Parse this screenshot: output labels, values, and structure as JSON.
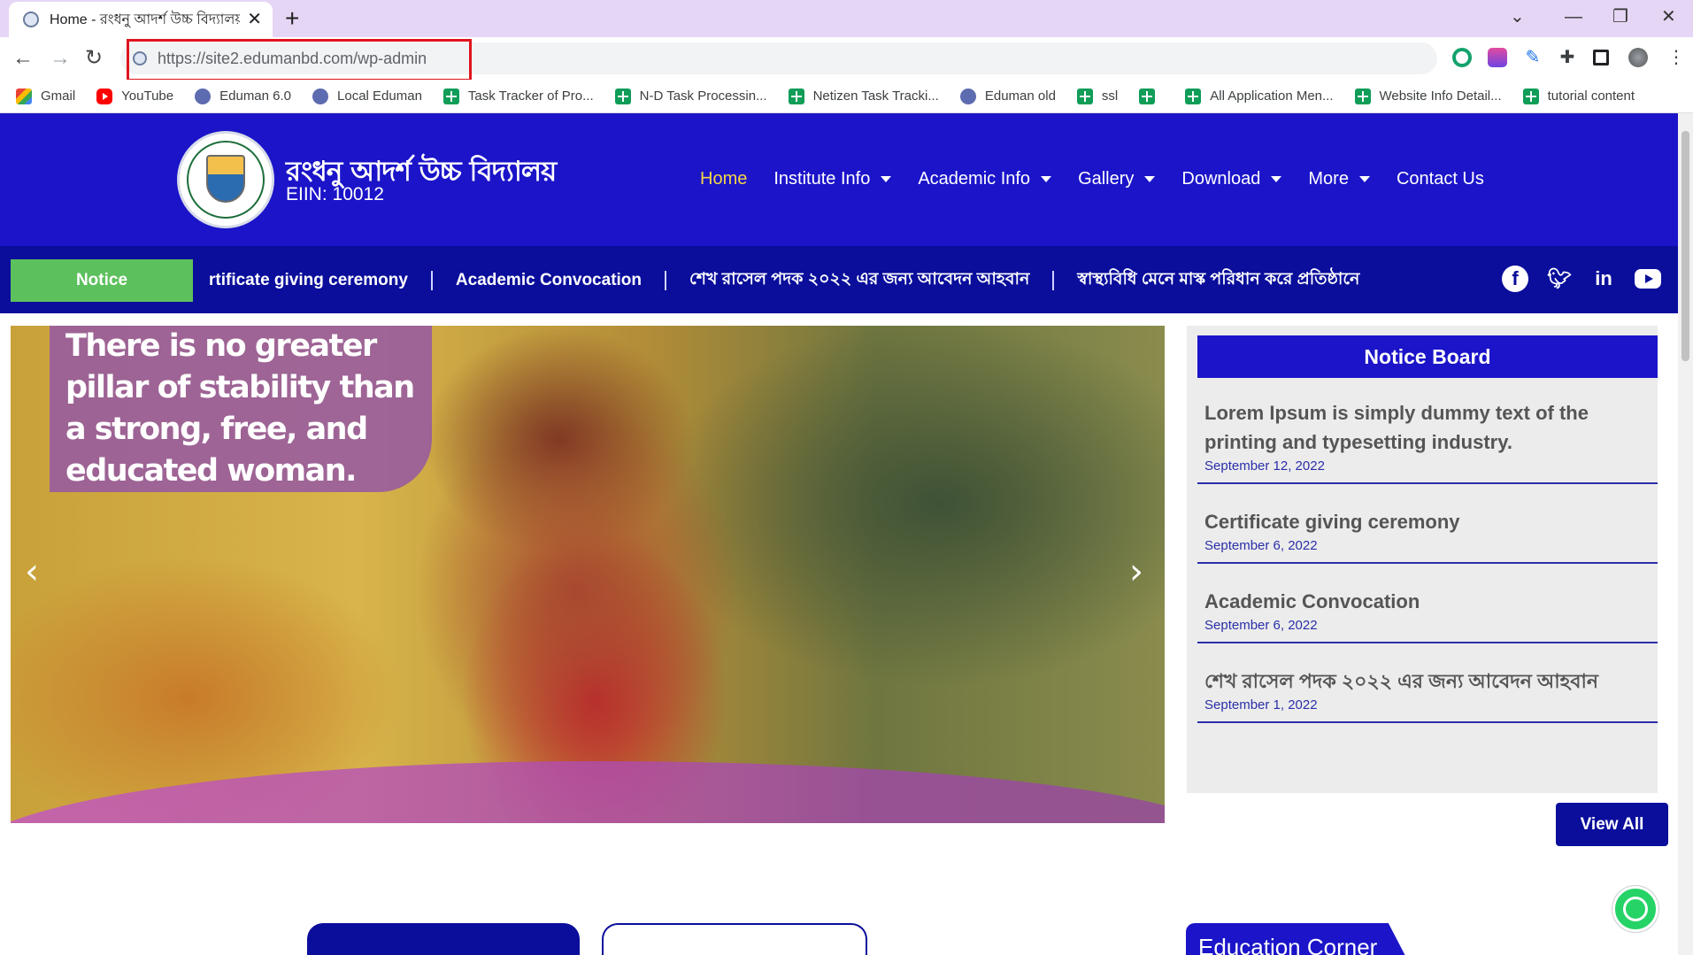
{
  "browser": {
    "tab_title": "Home - রংধনু আদর্শ উচ্চ বিদ্যালয়",
    "url": "https://site2.edumanbd.com/wp-admin",
    "bookmarks": [
      {
        "label": "Gmail",
        "icon": "gmail-icon"
      },
      {
        "label": "YouTube",
        "icon": "youtube-icon"
      },
      {
        "label": "Eduman 6.0",
        "icon": "eduman-icon"
      },
      {
        "label": "Local Eduman",
        "icon": "eduman-icon"
      },
      {
        "label": "Task Tracker of Pro...",
        "icon": "sheets-icon"
      },
      {
        "label": "N-D Task Processin...",
        "icon": "sheets-icon"
      },
      {
        "label": "Netizen Task Tracki...",
        "icon": "sheets-icon"
      },
      {
        "label": "Eduman old",
        "icon": "eduman-icon"
      },
      {
        "label": "ssl",
        "icon": "sheets-icon"
      },
      {
        "label": "",
        "icon": "sheets-icon"
      },
      {
        "label": "All Application Men...",
        "icon": "sheets-icon"
      },
      {
        "label": "Website Info Detail...",
        "icon": "sheets-icon"
      },
      {
        "label": "tutorial content",
        "icon": "sheets-icon"
      }
    ]
  },
  "site": {
    "school_name": "রংধনু আদর্শ উচ্চ বিদ্যালয়",
    "eiin": "EIIN: 10012",
    "nav": [
      {
        "label": "Home",
        "dropdown": false,
        "active": true
      },
      {
        "label": "Institute Info",
        "dropdown": true
      },
      {
        "label": "Academic Info",
        "dropdown": true
      },
      {
        "label": "Gallery",
        "dropdown": true
      },
      {
        "label": "Download",
        "dropdown": true
      },
      {
        "label": "More",
        "dropdown": true
      },
      {
        "label": "Contact Us",
        "dropdown": false
      }
    ]
  },
  "notice_bar": {
    "button_label": "Notice",
    "ticker": [
      "rtificate giving ceremony",
      "Academic Convocation",
      "শেখ রাসেল পদক ২০২২ এর জন্য আবেদন আহবান",
      "স্বাস্থ্যবিধি মেনে মাস্ক পরিধান করে প্রতিষ্ঠানে"
    ],
    "socials": [
      "facebook-icon",
      "twitter-icon",
      "linkedin-icon",
      "youtube-icon"
    ]
  },
  "hero": {
    "quote": "There is no greater pillar of stability than a strong, free, and educated woman."
  },
  "notice_board": {
    "title": "Notice Board",
    "items": [
      {
        "title": "Lorem Ipsum is simply dummy text of the printing and typesetting industry.",
        "date": "September 12, 2022"
      },
      {
        "title": "Certificate giving ceremony",
        "date": "September 6, 2022"
      },
      {
        "title": "Academic Convocation",
        "date": "September 6, 2022"
      },
      {
        "title": "শেখ রাসেল পদক ২০২২ এর জন্য আবেদন আহবান",
        "date": "September 1, 2022"
      }
    ],
    "view_all": "View All"
  },
  "sections": {
    "education_corner": "Education Corner"
  },
  "colors": {
    "header_blue": "#1b14c9",
    "notice_bar_blue": "#0a0e9b",
    "notice_green": "#5cc05c",
    "active_nav": "#f5d547",
    "highlight_red": "#e0141e"
  }
}
